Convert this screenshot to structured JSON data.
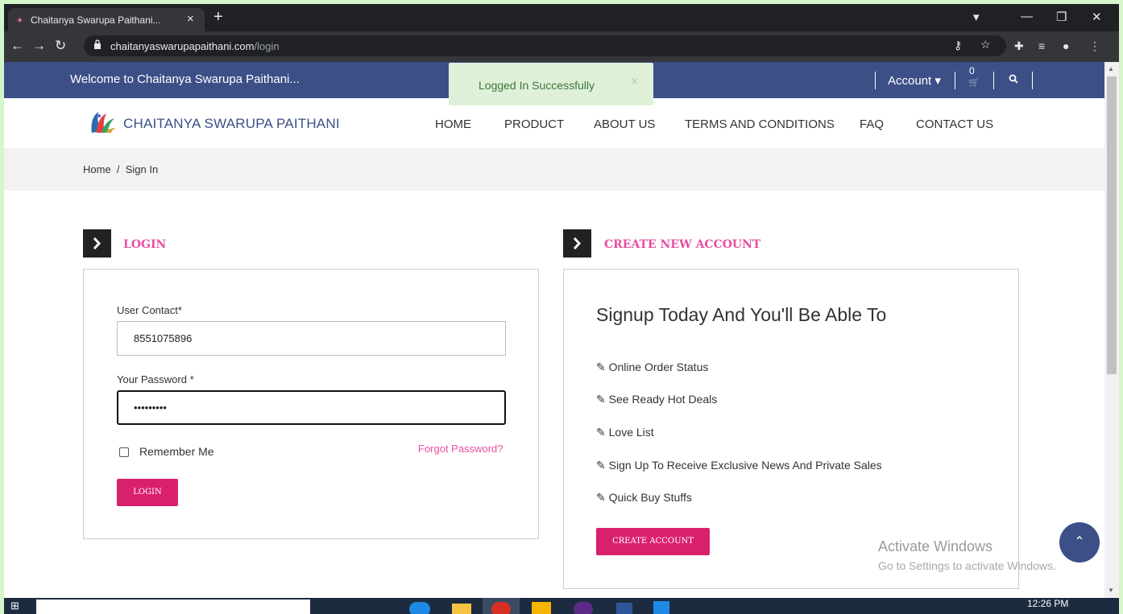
{
  "browser": {
    "tab_title": "Chaitanya Swarupa Paithani...",
    "tab_close": "×",
    "new_tab": "+",
    "url_host": "chaitanyaswarupapaithani.com",
    "url_path": "/login"
  },
  "topbar": {
    "welcome": "Welcome to Chaitanya Swarupa Paithani...",
    "account": "Account ▾",
    "cart_count": "0"
  },
  "toast": {
    "message": "Logged In Successfully",
    "close": "×"
  },
  "header": {
    "brand": "CHAITANYA SWARUPA PAITHANI",
    "nav": [
      "HOME",
      "PRODUCT",
      "ABOUT US",
      "TERMS AND CONDITIONS",
      "FAQ",
      "CONTACT US"
    ]
  },
  "breadcrumb": "Home  /  Sign In",
  "login": {
    "section_title": "LOGIN",
    "contact_label": "User Contact*",
    "contact_value": "8551075896",
    "password_label": "Your Password *",
    "password_value": "•••••••••",
    "remember_label": "Remember Me",
    "forgot_link": "Forgot Password?",
    "login_button": "LOGIN"
  },
  "create": {
    "section_title": "CREATE NEW ACCOUNT",
    "heading": "Signup Today And You'll Be Able To",
    "benefits": [
      "Online Order Status",
      "See Ready Hot Deals",
      "Love List",
      "Sign Up To Receive Exclusive News And Private Sales",
      "Quick Buy Stuffs"
    ],
    "create_button": "CREATE ACCOUNT"
  },
  "watermark": {
    "line1": "Activate Windows",
    "line2": "Go to Settings to activate Windows."
  },
  "taskbar": {
    "clock": "12:26 PM"
  },
  "colors": {
    "brand_blue": "#3c4f87",
    "accent_pink": "#e94ea2",
    "button_pink": "#d9206e",
    "toast_green": "#dff0d8"
  },
  "icons": [
    "favicon-icon",
    "close-icon",
    "back-icon",
    "forward-icon",
    "reload-icon",
    "lock-icon",
    "key-icon",
    "star-icon",
    "extensions-icon",
    "playlist-icon",
    "profile-icon",
    "menu-icon",
    "cart-icon",
    "search-icon",
    "peacock-logo-icon",
    "chevron-right-icon",
    "edit-icon",
    "chevron-up-icon"
  ]
}
